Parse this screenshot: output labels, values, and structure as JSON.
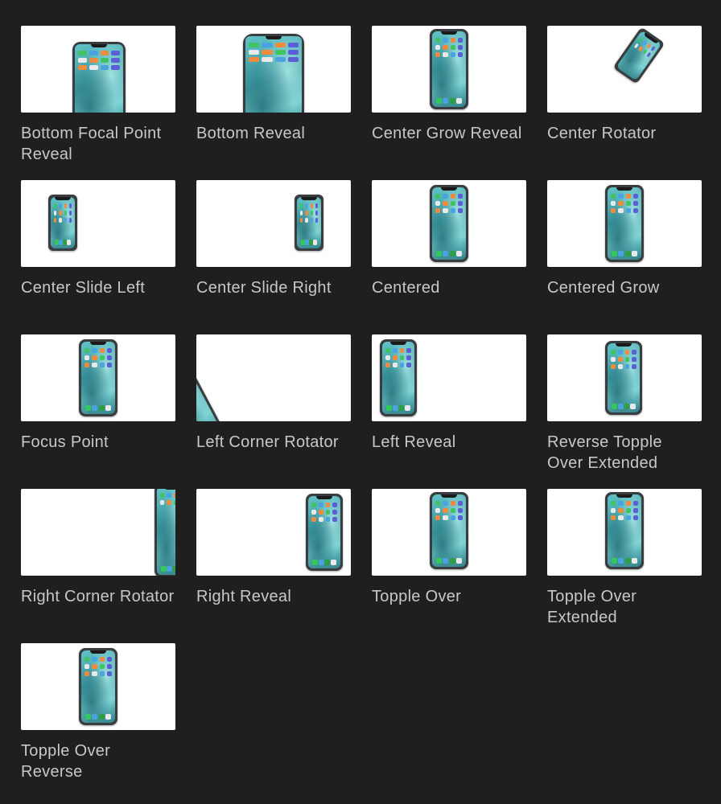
{
  "items": [
    {
      "label": "Bottom Focal Point Reveal",
      "preview": "phone-enlarged-bottom"
    },
    {
      "label": "Bottom Reveal",
      "preview": "phone-enlarged-bottom"
    },
    {
      "label": "Center Grow Reveal",
      "preview": "phone-center"
    },
    {
      "label": "Center Rotator",
      "preview": "phone-rotated-small"
    },
    {
      "label": "Center Slide Left",
      "preview": "phone-left"
    },
    {
      "label": "Center Slide Right",
      "preview": "phone-right"
    },
    {
      "label": "Centered",
      "preview": "phone-center"
    },
    {
      "label": "Centered Grow",
      "preview": "phone-center"
    },
    {
      "label": "Focus Point",
      "preview": "phone-center"
    },
    {
      "label": "Left Corner Rotator",
      "preview": "phone-corner-left"
    },
    {
      "label": "Left Reveal",
      "preview": "phone-left"
    },
    {
      "label": "Reverse Topple Over Extended",
      "preview": "phone-center"
    },
    {
      "label": "Right Corner Rotator",
      "preview": "phone-corner-right"
    },
    {
      "label": "Right Reveal",
      "preview": "phone-right"
    },
    {
      "label": "Topple Over",
      "preview": "phone-center"
    },
    {
      "label": "Topple Over Extended",
      "preview": "phone-center"
    },
    {
      "label": "Topple Over Reverse",
      "preview": "phone-center"
    }
  ]
}
